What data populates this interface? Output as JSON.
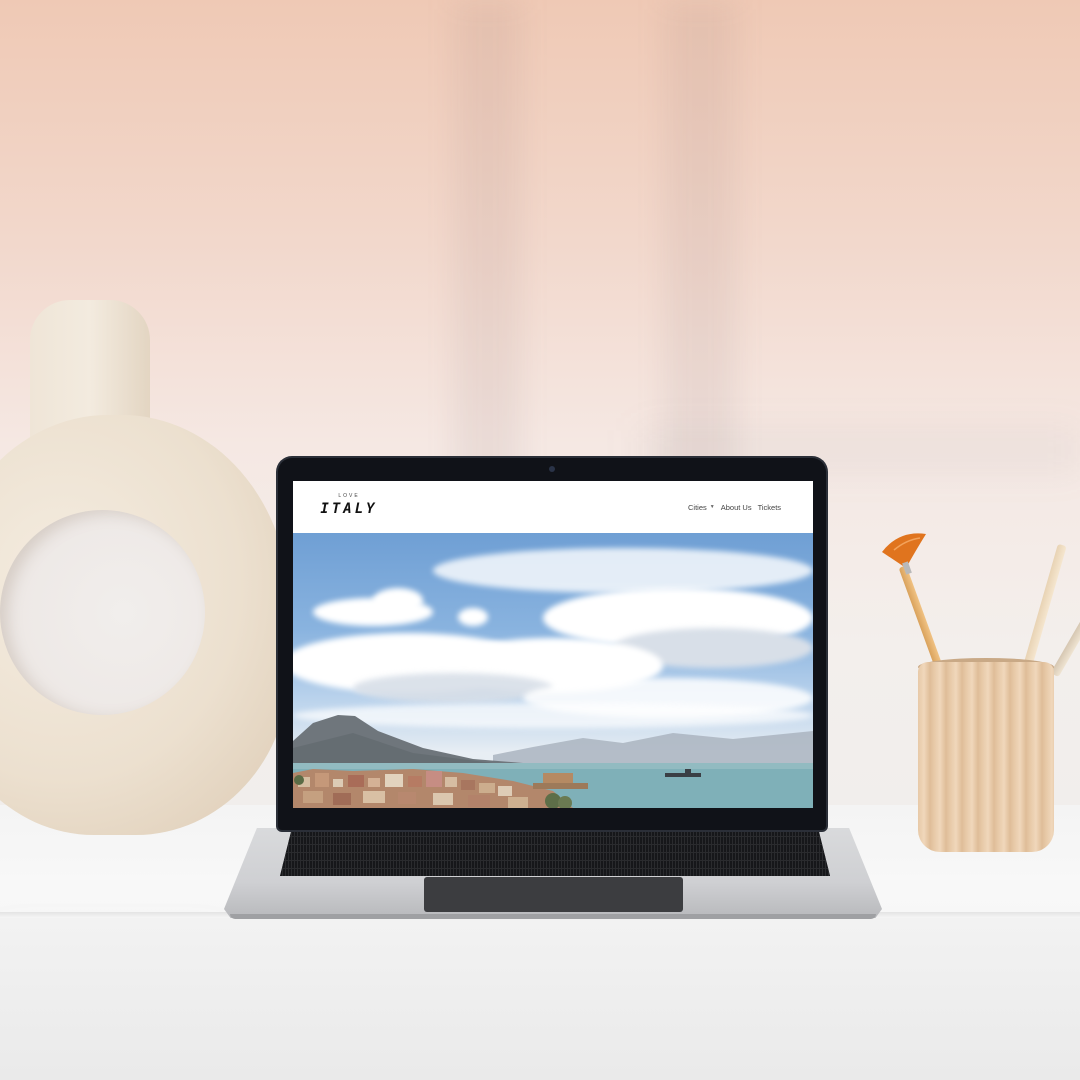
{
  "site": {
    "logo_small": "LOVE",
    "logo_main": "ITALY"
  },
  "nav": {
    "items": [
      {
        "label": "Cities",
        "has_dropdown": true
      },
      {
        "label": "About Us",
        "has_dropdown": false
      },
      {
        "label": "Tickets",
        "has_dropdown": false
      }
    ]
  },
  "icons": {
    "cities_dropdown": "chevron-down-icon"
  },
  "colors": {
    "header_bg": "#ffffff",
    "nav_text": "#444444",
    "logo_text": "#111111",
    "sky": "#7fa9d9",
    "sea": "#7fb0b8"
  }
}
